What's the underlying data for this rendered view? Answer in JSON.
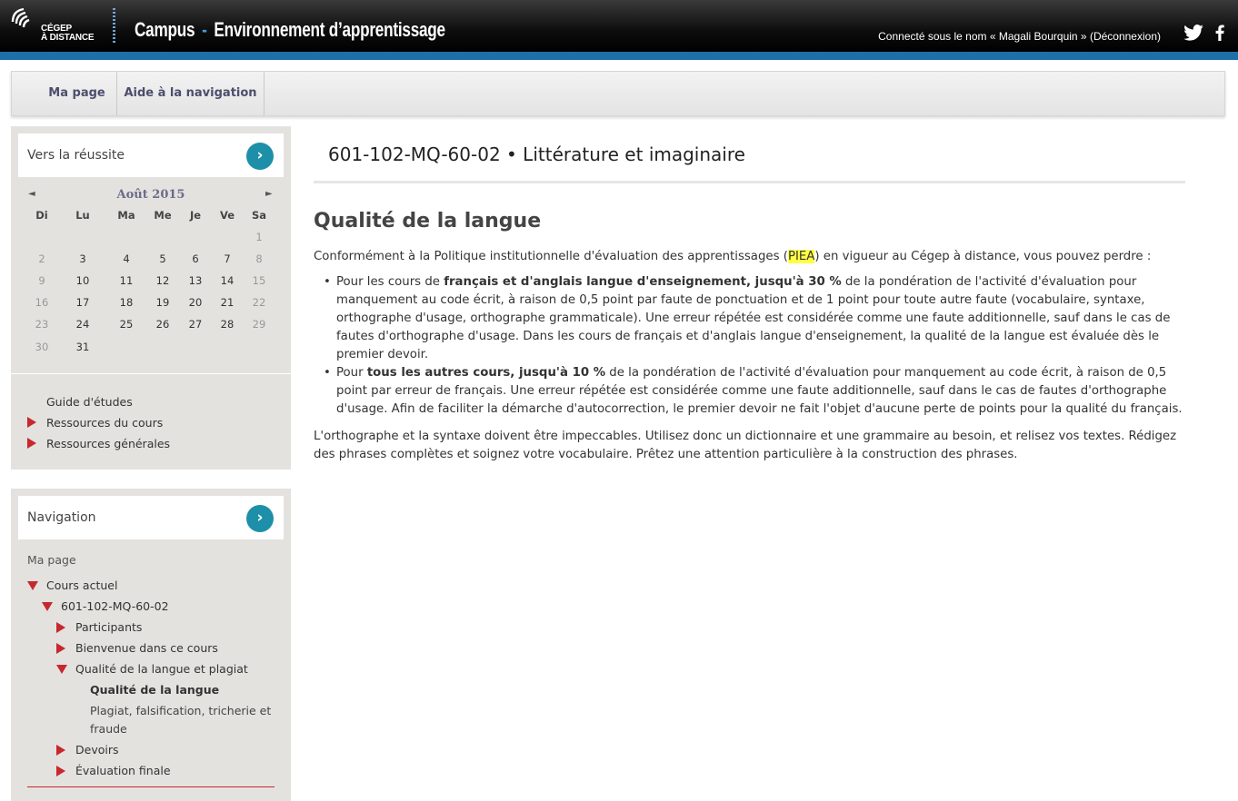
{
  "header": {
    "logo_line1": "CÉGEP",
    "logo_line2": "À DISTANCE",
    "title_part1": "Campus",
    "title_sep": "-",
    "title_part2": "Environnement d’apprentissage",
    "login_text": "Connecté sous le nom « Magali Bourquin »",
    "logout_label": "(Déconnexion)",
    "social": [
      "twitter-icon",
      "facebook-icon"
    ]
  },
  "navbar": {
    "items": [
      "Ma page",
      "Aide à la navigation"
    ]
  },
  "block_success": {
    "title": "Vers la réussite",
    "calendar": {
      "month": "Août 2015",
      "prev": "◄",
      "next": "►",
      "weekdays": [
        "Di",
        "Lu",
        "Ma",
        "Me",
        "Je",
        "Ve",
        "Sa"
      ],
      "weeks": [
        [
          "",
          "",
          "",
          "",
          "",
          "",
          "1"
        ],
        [
          "2",
          "3",
          "4",
          "5",
          "6",
          "7",
          "8"
        ],
        [
          "9",
          "10",
          "11",
          "12",
          "13",
          "14",
          "15"
        ],
        [
          "16",
          "17",
          "18",
          "19",
          "20",
          "21",
          "22"
        ],
        [
          "23",
          "24",
          "25",
          "26",
          "27",
          "28",
          "29"
        ],
        [
          "30",
          "31",
          "",
          "",
          "",
          "",
          ""
        ]
      ]
    },
    "links": [
      "Guide d'études",
      "Ressources du cours",
      "Ressources générales"
    ]
  },
  "block_navigation": {
    "title": "Navigation",
    "items": {
      "my_page": "Ma page",
      "current_course": "Cours actuel",
      "course_code": "601-102-MQ-60-02",
      "participants": "Participants",
      "welcome": "Bienvenue dans ce cours",
      "quality_plagiarism": "Qualité de la langue et plagiat",
      "quality_language": "Qualité de la langue",
      "plagiarism_line1": "Plagiat, falsification, tricherie et",
      "plagiarism_line2": "fraude",
      "assignments": "Devoirs",
      "final_evaluation": "Évaluation finale"
    }
  },
  "main": {
    "course_title": "601-102-MQ-60-02 • Littérature et imaginaire",
    "page_title": "Qualité de la langue",
    "intro_before": "Conformément à la Politique institutionnelle d'évaluation des apprentissages (",
    "intro_highlight": "PIEA",
    "intro_after": ") en vigueur au Cégep à distance, vous pouvez perdre :",
    "bullet1_before": "Pour les cours de ",
    "bullet1_bold": "français et d'anglais langue d'enseignement, jusqu'à 30 %",
    "bullet1_after": " de la pondération de l'activité d'évaluation pour manquement au code écrit, à raison de 0,5 point par faute de ponctuation et de 1 point pour toute autre faute (vocabulaire, syntaxe, orthographe d'usage, orthographe grammaticale). Une erreur répétée est considérée comme une faute additionnelle, sauf dans le cas de fautes d'orthographe d'usage. Dans les cours de français et d'anglais langue d'enseignement, la qualité de la langue est évaluée dès le premier devoir.",
    "bullet2_before": "Pour ",
    "bullet2_bold": "tous les autres cours, jusqu'à 10 %",
    "bullet2_after": " de la pondération de l'activité d'évaluation pour manquement au code écrit, à raison de 0,5 point par erreur de français. Une erreur répétée est considérée comme une faute additionnelle, sauf dans le cas de fautes d'orthographe d'usage. Afin de faciliter la démarche d'autocorrection, le premier devoir ne fait l'objet d'aucune perte de points pour la qualité du français.",
    "closing": "L'orthographe et la syntaxe doivent être impeccables. Utilisez donc un dictionnaire et une grammaire au besoin, et relisez vos textes. Rédigez des phrases complètes et soignez votre vocabulaire. Prêtez une attention particulière à la construction des phrases."
  }
}
